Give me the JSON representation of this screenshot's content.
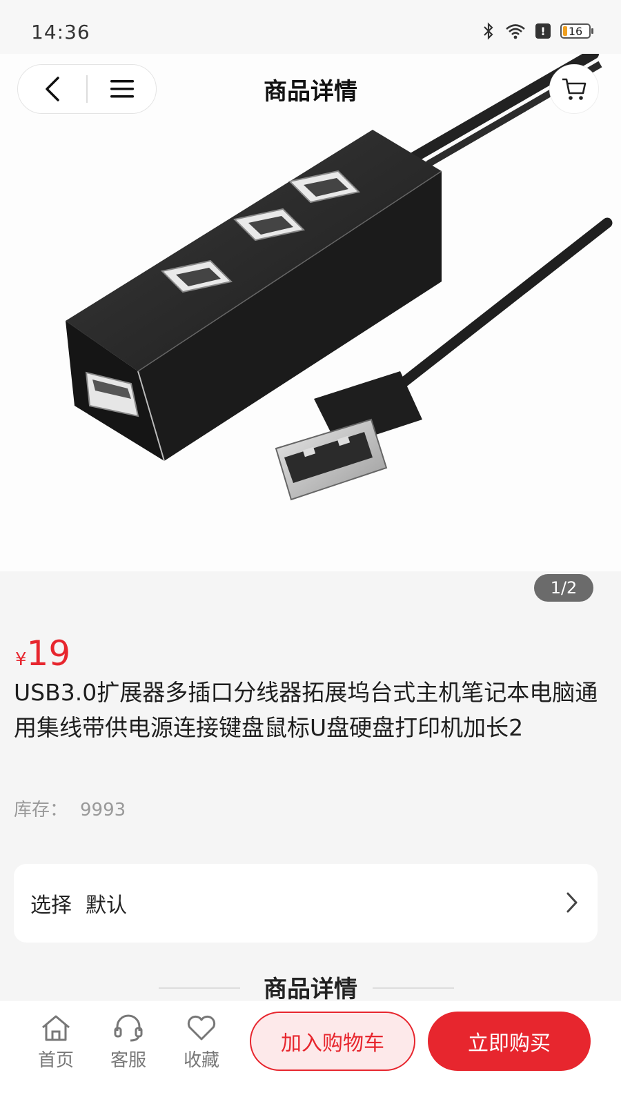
{
  "status_bar": {
    "time": "14:36",
    "battery": "16"
  },
  "header": {
    "title": "商品详情"
  },
  "gallery": {
    "indicator": "1/2"
  },
  "product": {
    "price_symbol": "¥",
    "price": "19",
    "title": "USB3.0扩展器多插口分线器拓展坞台式主机笔记本电脑通用集线带供电源连接键盘鼠标U盘硬盘打印机加长2",
    "stock_label": "库存：",
    "stock_value": "9993"
  },
  "selection": {
    "label": "选择",
    "value": "默认"
  },
  "details_heading": "商品详情",
  "bottom_bar": {
    "tabs": [
      {
        "label": "首页",
        "icon": "home-icon"
      },
      {
        "label": "客服",
        "icon": "headset-icon"
      },
      {
        "label": "收藏",
        "icon": "heart-icon"
      }
    ],
    "add_to_cart": "加入购物车",
    "buy_now": "立即购买"
  },
  "colors": {
    "accent": "#e7262e",
    "accent_light": "#fde9ea"
  }
}
